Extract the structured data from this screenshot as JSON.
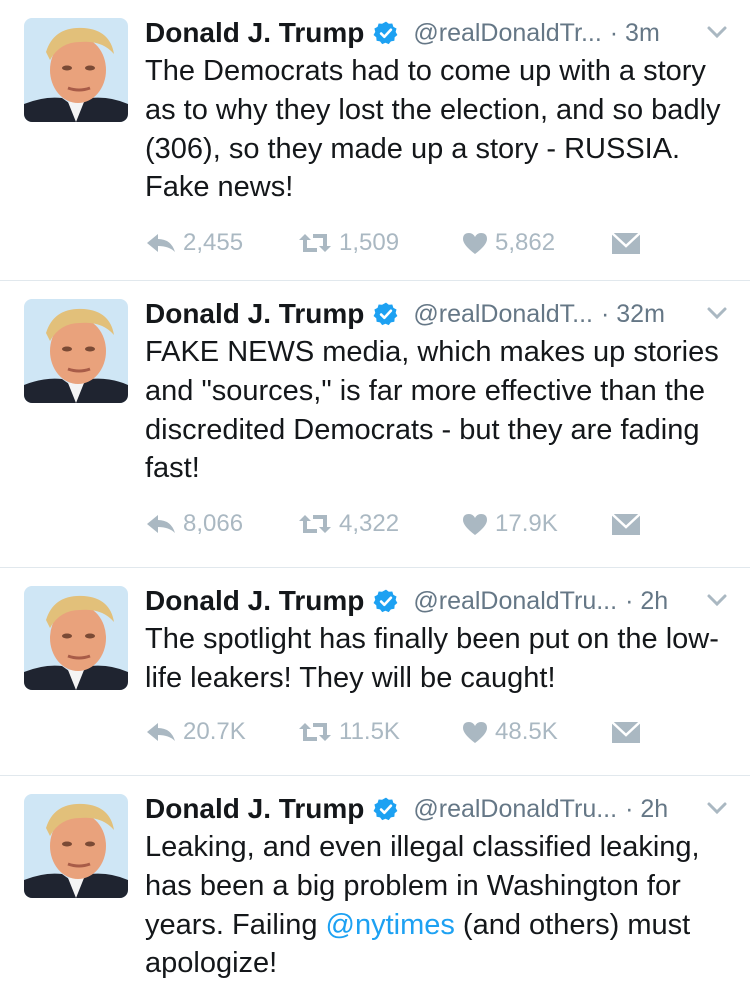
{
  "tweets": [
    {
      "name": "Donald J. Trump",
      "handle": "@realDonaldTr...",
      "time": "· 3m",
      "text_parts": [
        "The Democrats had to come up with a story as to why they lost the election, and so badly (306), so they made up a story - RUSSIA. Fake news!"
      ],
      "replies": "2,455",
      "retweets": "1,509",
      "likes": "5,862"
    },
    {
      "name": "Donald J. Trump",
      "handle": "@realDonaldT...",
      "time": "· 32m",
      "text_parts": [
        "FAKE NEWS media, which makes up stories and \"sources,\" is far more effective than the discredited Democrats - but they are fading fast!"
      ],
      "replies": "8,066",
      "retweets": "4,322",
      "likes": "17.9K"
    },
    {
      "name": "Donald J. Trump",
      "handle": "@realDonaldTru...",
      "time": "· 2h",
      "text_parts": [
        "The spotlight has finally been put on the low-life leakers! They will be caught!"
      ],
      "replies": "20.7K",
      "retweets": "11.5K",
      "likes": "48.5K"
    },
    {
      "name": "Donald J. Trump",
      "handle": "@realDonaldTru...",
      "time": "· 2h",
      "text_before": "Leaking, and even illegal classified leaking, has been a big problem in Washington for years. Failing ",
      "mention": "@nytimes",
      "text_after": " (and others) must apologize!"
    }
  ],
  "icons": {
    "verified": "verified-badge-icon",
    "more": "chevron-down-icon",
    "reply": "reply-icon",
    "retweet": "retweet-icon",
    "like": "heart-icon",
    "dm": "direct-message-icon"
  },
  "colors": {
    "text": "#14171a",
    "secondary": "#657786",
    "action": "#aab8c2",
    "verified": "#1da1f2",
    "link": "#1da1f2",
    "divider": "#e1e8ed"
  }
}
